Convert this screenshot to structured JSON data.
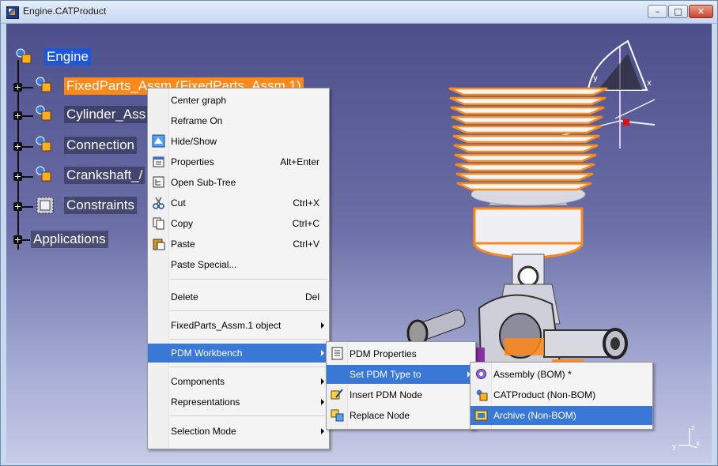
{
  "window": {
    "title": "Engine.CATProduct",
    "buttons": {
      "minimize": "–",
      "maximize": "□",
      "close": "✕"
    }
  },
  "tree": {
    "root": "Engine",
    "items": [
      {
        "label": "FixedParts_Assm (FixedParts_Assm.1)"
      },
      {
        "label": "Cylinder_Ass"
      },
      {
        "label": "Connection"
      },
      {
        "label": "Crankshaft_/"
      },
      {
        "label": "Constraints"
      },
      {
        "label": "Applications"
      }
    ]
  },
  "context_menu": {
    "items": [
      {
        "label": "Center graph",
        "shortcut": "",
        "icon": ""
      },
      {
        "label": "Reframe On",
        "shortcut": "",
        "icon": ""
      },
      {
        "label": "Hide/Show",
        "shortcut": "",
        "icon": "hide-show-icon"
      },
      {
        "label": "Properties",
        "shortcut": "Alt+Enter",
        "icon": "properties-icon"
      },
      {
        "label": "Open Sub-Tree",
        "shortcut": "",
        "icon": "sub-tree-icon"
      },
      {
        "label": "Cut",
        "shortcut": "Ctrl+X",
        "icon": "scissors-icon"
      },
      {
        "label": "Copy",
        "shortcut": "Ctrl+C",
        "icon": "copy-icon"
      },
      {
        "label": "Paste",
        "shortcut": "Ctrl+V",
        "icon": "paste-icon"
      },
      {
        "label": "Paste Special...",
        "shortcut": "",
        "icon": ""
      },
      {
        "label": "Delete",
        "shortcut": "Del",
        "icon": ""
      },
      {
        "label": "FixedParts_Assm.1 object",
        "shortcut": "",
        "icon": ""
      },
      {
        "label": "PDM Workbench",
        "shortcut": "",
        "icon": ""
      },
      {
        "label": "Components",
        "shortcut": "",
        "icon": ""
      },
      {
        "label": "Representations",
        "shortcut": "",
        "icon": ""
      },
      {
        "label": "Selection Mode",
        "shortcut": "",
        "icon": ""
      }
    ]
  },
  "pdm_menu": {
    "items": [
      {
        "label": "PDM Properties",
        "icon": "pdm-properties-icon"
      },
      {
        "label": "Set PDM Type to",
        "icon": ""
      },
      {
        "label": "Insert PDM Node",
        "icon": "insert-node-icon"
      },
      {
        "label": "Replace Node",
        "icon": "replace-node-icon"
      }
    ]
  },
  "type_menu": {
    "items": [
      {
        "label": "Assembly (BOM) *",
        "icon": "assembly-icon"
      },
      {
        "label": "CATProduct (Non-BOM)",
        "icon": "catproduct-icon"
      },
      {
        "label": "Archive (Non-BOM)",
        "icon": "archive-icon"
      }
    ]
  },
  "compass": {
    "x_label": "x",
    "y_label": "y"
  },
  "axis_triad": {
    "x": "x",
    "y": "y",
    "z": "z"
  },
  "colors": {
    "selection_orange": "#ff8a1a",
    "menu_highlight": "#3a78d8",
    "tree_selection": "#1e57d6",
    "background_top": "#4d4f8b"
  }
}
